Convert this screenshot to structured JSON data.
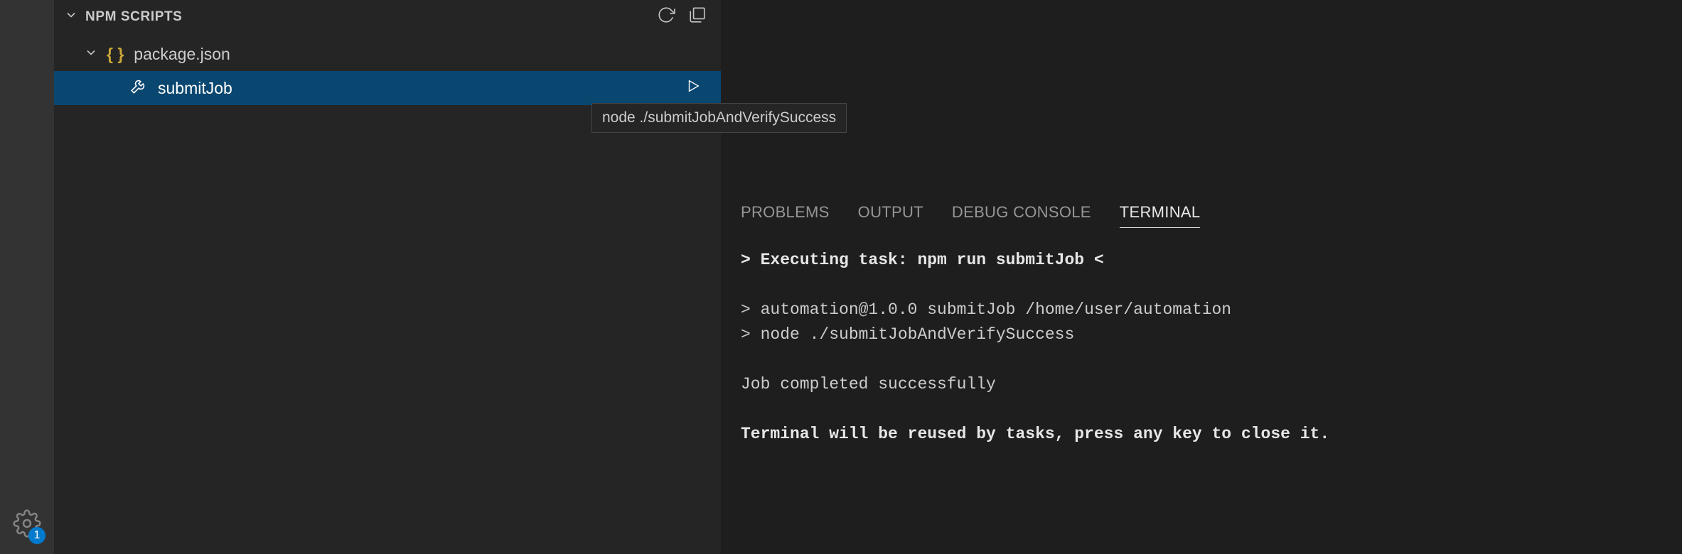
{
  "sidebar": {
    "sectionTitle": "NPM SCRIPTS",
    "packageName": "package.json",
    "scriptName": "submitJob",
    "tooltip": "node ./submitJobAndVerifySuccess"
  },
  "activity": {
    "badgeCount": "1"
  },
  "panel": {
    "tabs": {
      "problems": "PROBLEMS",
      "output": "OUTPUT",
      "debugConsole": "DEBUG CONSOLE",
      "terminal": "TERMINAL"
    },
    "terminal": {
      "line1": "> Executing task: npm run submitJob <",
      "line2": "> automation@1.0.0 submitJob /home/user/automation",
      "line3": "> node ./submitJobAndVerifySuccess",
      "line4": "Job completed successfully",
      "line5": "Terminal will be reused by tasks, press any key to close it."
    }
  }
}
